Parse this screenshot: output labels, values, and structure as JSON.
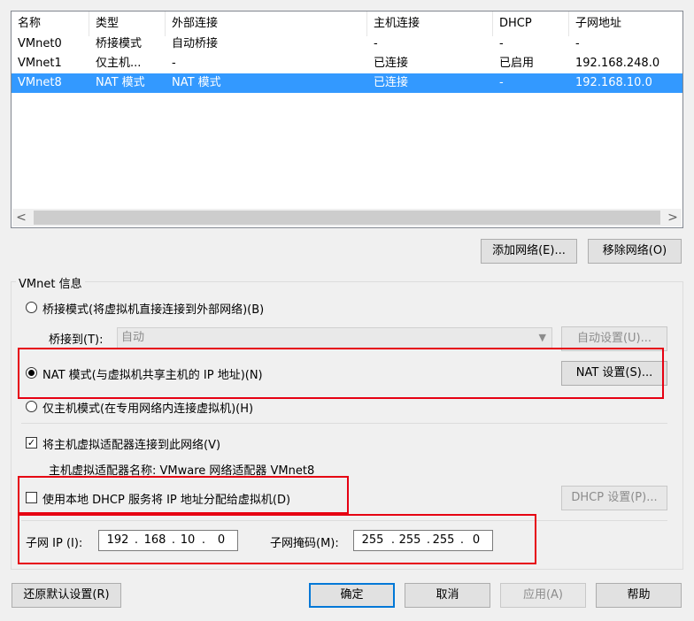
{
  "table": {
    "columns": [
      "名称",
      "类型",
      "外部连接",
      "主机连接",
      "DHCP",
      "子网地址"
    ],
    "rows": [
      [
        "VMnet0",
        "桥接模式",
        "自动桥接",
        "-",
        "-",
        "-"
      ],
      [
        "VMnet1",
        "仅主机...",
        "-",
        "已连接",
        "已启用",
        "192.168.248.0"
      ],
      [
        "VMnet8",
        "NAT 模式",
        "NAT 模式",
        "已连接",
        "-",
        "192.168.10.0"
      ]
    ],
    "selected_row": 2
  },
  "scrollbar": {
    "left_arrow": "<",
    "right_arrow": ">"
  },
  "buttons": {
    "add_network": "添加网络(E)...",
    "remove_network": "移除网络(O)",
    "restore_defaults": "还原默认设置(R)",
    "ok": "确定",
    "cancel": "取消",
    "apply": "应用(A)",
    "help": "帮助"
  },
  "vmnet_info": {
    "title": "VMnet 信息",
    "bridged_label": "桥接模式(将虚拟机直接连接到外部网络)(B)",
    "bridged_to_label": "桥接到(T):",
    "bridged_to_value": "自动",
    "auto_settings": "自动设置(U)...",
    "nat_label": "NAT 模式(与虚拟机共享主机的 IP 地址)(N)",
    "nat_settings": "NAT 设置(S)...",
    "hostonly_label": "仅主机模式(在专用网络内连接虚拟机)(H)",
    "connect_adapter_label": "将主机虚拟适配器连接到此网络(V)",
    "connect_adapter_checked": true,
    "adapter_name_text": "主机虚拟适配器名称: VMware 网络适配器 VMnet8",
    "dhcp_label": "使用本地 DHCP 服务将 IP 地址分配给虚拟机(D)",
    "dhcp_checked": false,
    "dhcp_settings": "DHCP 设置(P)...",
    "selected_mode": "nat",
    "subnet_ip_label": "子网 IP (I):",
    "subnet_ip": [
      "192",
      "168",
      "10",
      "0"
    ],
    "subnet_mask_label": "子网掩码(M):",
    "subnet_mask": [
      "255",
      "255",
      "255",
      "0"
    ],
    "check_mark": "✓",
    "dot": "."
  },
  "colors": {
    "selection": "#3399ff",
    "highlight_box": "#e60012",
    "primary_border": "#0078d7"
  }
}
